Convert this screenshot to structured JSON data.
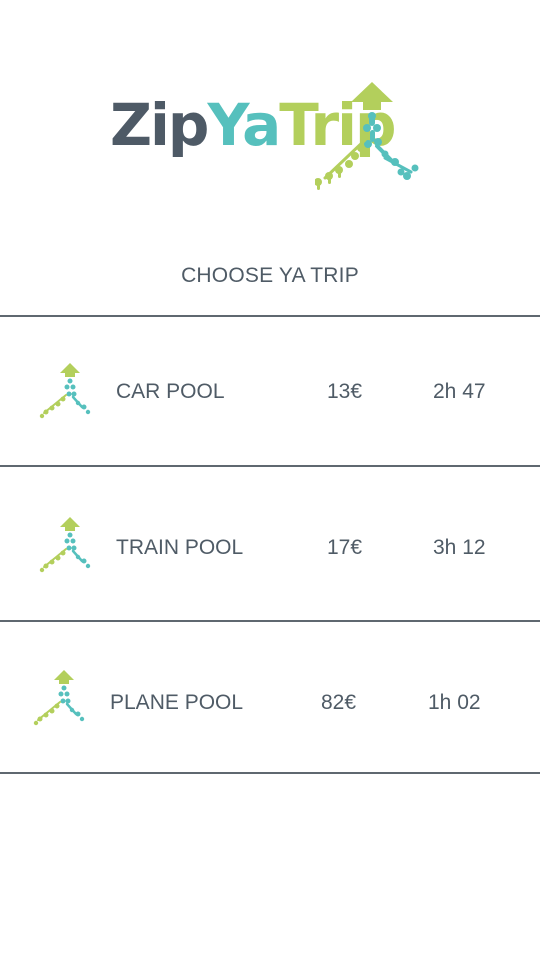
{
  "brand": {
    "part1": "Zip",
    "part2": "Ya",
    "part3": "Trip",
    "colors": {
      "dark": "#4e5a66",
      "teal": "#56c0bd",
      "green": "#b3cf5c"
    },
    "logo_icon": "dangling-arrow-tree-icon"
  },
  "screen": {
    "title": "CHOOSE YA TRIP"
  },
  "trips": [
    {
      "name": "CAR POOL",
      "price": "13€",
      "duration": "2h 47",
      "icon": "trip-logo-icon"
    },
    {
      "name": "TRAIN POOL",
      "price": "17€",
      "duration": "3h 12",
      "icon": "trip-logo-icon"
    },
    {
      "name": "PLANE POOL",
      "price": "82€",
      "duration": "1h 02",
      "icon": "trip-logo-icon"
    }
  ]
}
